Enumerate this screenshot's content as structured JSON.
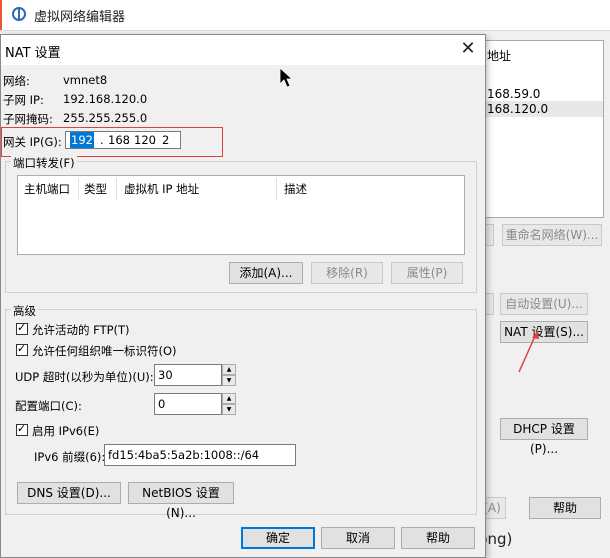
{
  "bg_window": {
    "title": "虚拟网络编辑器",
    "list_header": "地址",
    "list_rows": [
      "168.59.0",
      "168.120.0"
    ],
    "rename_network_button": "重命名网络(W)...",
    "auto_settings_button": "自动设置(U)...",
    "nat_settings_button": "NAT 设置(S)...",
    "dhcp_settings_button": "DHCP 设置(P)...",
    "help_button": "帮助",
    "apply_fragment": "(A)",
    "bottom_text": "png)"
  },
  "dialog": {
    "title": "NAT 设置",
    "network_label": "网络:",
    "network_value": "vmnet8",
    "subnet_ip_label": "子网 IP:",
    "subnet_ip_value": "192.168.120.0",
    "subnet_mask_label": "子网掩码:",
    "subnet_mask_value": "255.255.255.0",
    "gateway_label": "网关 IP(G):",
    "gateway_ip": {
      "o1": "192",
      "o2": "168",
      "o3": "120",
      "o4": "2"
    },
    "port_forward": {
      "title": "端口转发(F)",
      "columns": [
        "主机端口",
        "类型",
        "虚拟机 IP 地址",
        "描述"
      ],
      "add_button": "添加(A)...",
      "remove_button": "移除(R)",
      "properties_button": "属性(P)"
    },
    "advanced": {
      "title": "高级",
      "allow_active_ftp": "允许活动的 FTP(T)",
      "allow_any_oui": "允许任何组织唯一标识符(O)",
      "udp_timeout_label": "UDP 超时(以秒为单位)(U):",
      "udp_timeout_value": "30",
      "config_port_label": "配置端口(C):",
      "config_port_value": "0",
      "enable_ipv6": "启用 IPv6(E)",
      "ipv6_prefix_label": "IPv6 前缀(6):",
      "ipv6_prefix_value": "fd15:4ba5:5a2b:1008::/64",
      "dns_button": "DNS 设置(D)...",
      "netbios_button": "NetBIOS 设置(N)..."
    },
    "ok_button": "确定",
    "cancel_button": "取消",
    "help_button": "帮助"
  },
  "colors": {
    "accent": "#0078d7",
    "annotation": "#e04040"
  }
}
